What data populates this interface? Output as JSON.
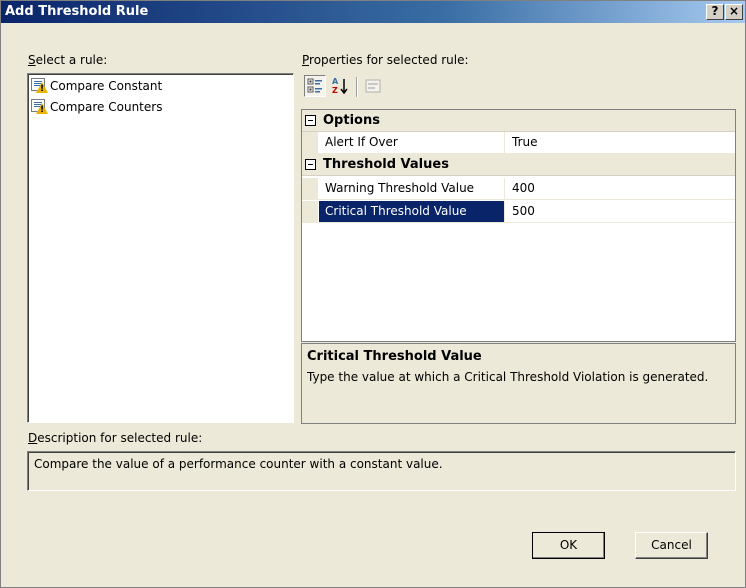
{
  "window": {
    "title": "Add Threshold Rule",
    "help_button": "?",
    "close_button": "×"
  },
  "rules": {
    "label_hotkey": "S",
    "label_rest": "elect a rule:",
    "items": [
      {
        "label": "Compare Constant",
        "icon": "rule-warning-icon"
      },
      {
        "label": "Compare Counters",
        "icon": "rule-warning-icon"
      }
    ]
  },
  "properties": {
    "label_hotkey": "P",
    "label_rest": "roperties for selected rule:",
    "toolbar": [
      "categorized-icon",
      "alphabetical-icon",
      "property-pages-icon"
    ],
    "categories": [
      {
        "name": "Options",
        "rows": [
          {
            "name": "Alert If Over",
            "value": "True",
            "selected": false
          }
        ]
      },
      {
        "name": "Threshold Values",
        "rows": [
          {
            "name": "Warning Threshold Value",
            "value": "400",
            "selected": false
          },
          {
            "name": "Critical Threshold Value",
            "value": "500",
            "selected": true
          }
        ]
      }
    ],
    "help": {
      "title": "Critical Threshold Value",
      "text": "Type the value at which a Critical Threshold Violation is generated."
    }
  },
  "description": {
    "label_hotkey": "D",
    "label_rest": "escription for selected rule:",
    "text": "Compare the value of a performance counter with a constant value."
  },
  "buttons": {
    "ok": "OK",
    "cancel": "Cancel"
  },
  "colors": {
    "title_bar": "#0a246a",
    "dialog_face": "#ece9d8",
    "selection": "#0a246a"
  }
}
